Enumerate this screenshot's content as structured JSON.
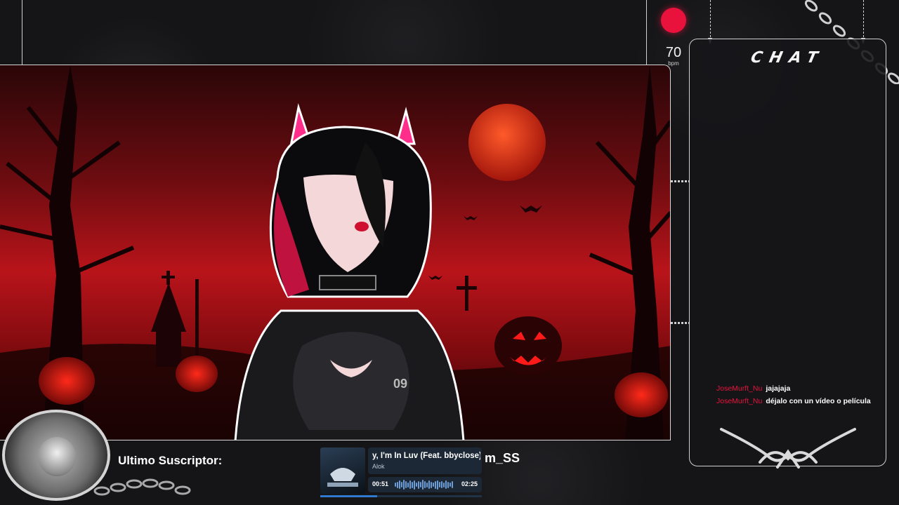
{
  "heart": {
    "bpm": "70",
    "unit": "bpm",
    "color": "#e8123c"
  },
  "chat": {
    "title": "CHAT",
    "messages": [
      {
        "user": "JoseMurft_Nu",
        "text": "jajajaja"
      },
      {
        "user": "JoseMurft_Nu",
        "text": "déjalo con un vídeo o película"
      }
    ]
  },
  "subscriber": {
    "label": "Ultimo Suscriptor:",
    "name": "m_SS"
  },
  "music": {
    "title": "y, I'm In Luv (Feat. bbyclose)",
    "artist": "Alok",
    "elapsed": "00:51",
    "duration": "02:25",
    "progress": 0.35
  },
  "theme": {
    "accent": "#e8123c",
    "panel_border": "#cfcfcf",
    "player_bg": "#1d2836",
    "player_accent": "#2f79d0"
  },
  "icons": [
    "heart-rate-dot",
    "chain-decoration",
    "logo-emblem",
    "album-cover",
    "waveform-icon",
    "chat-emblem-icon"
  ]
}
